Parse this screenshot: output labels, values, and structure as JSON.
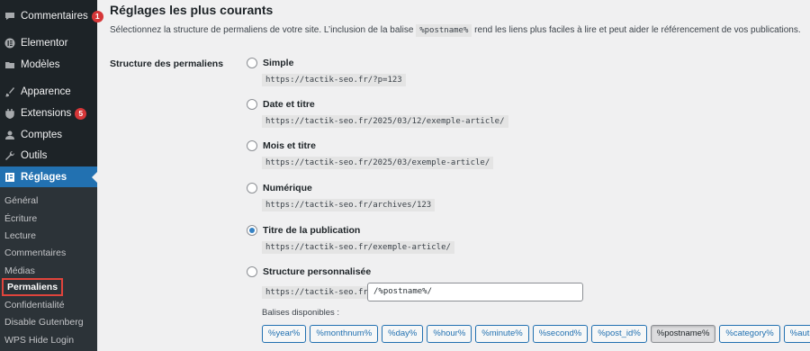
{
  "sidebar": {
    "items": [
      {
        "label": "Commentaires",
        "icon": "comment-icon",
        "badge": "1"
      },
      {
        "label": "Elementor",
        "icon": "elementor-icon"
      },
      {
        "label": "Modèles",
        "icon": "folder-icon"
      },
      {
        "label": "Apparence",
        "icon": "brush-icon"
      },
      {
        "label": "Extensions",
        "icon": "plugin-icon",
        "badge": "5"
      },
      {
        "label": "Comptes",
        "icon": "user-icon"
      },
      {
        "label": "Outils",
        "icon": "wrench-icon"
      },
      {
        "label": "Réglages",
        "icon": "settings-icon"
      }
    ],
    "submenu": [
      "Général",
      "Écriture",
      "Lecture",
      "Commentaires",
      "Médias",
      "Permaliens",
      "Confidentialité",
      "Disable Gutenberg",
      "WPS Hide Login"
    ]
  },
  "section": {
    "title": "Réglages les plus courants",
    "desc_before": "Sélectionnez la structure de permaliens de votre site. L’inclusion de la balise",
    "desc_code": "%postname%",
    "desc_after": "rend les liens plus faciles à lire et peut aider le référencement de vos publications."
  },
  "field_label": "Structure des permaliens",
  "options": [
    {
      "label": "Simple",
      "url": "https://tactik-seo.fr/?p=123",
      "checked": false
    },
    {
      "label": "Date et titre",
      "url": "https://tactik-seo.fr/2025/03/12/exemple-article/",
      "checked": false
    },
    {
      "label": "Mois et titre",
      "url": "https://tactik-seo.fr/2025/03/exemple-article/",
      "checked": false
    },
    {
      "label": "Numérique",
      "url": "https://tactik-seo.fr/archives/123",
      "checked": false
    },
    {
      "label": "Titre de la publication",
      "url": "https://tactik-seo.fr/exemple-article/",
      "checked": true
    },
    {
      "label": "Structure personnalisée",
      "url": "https://tactik-seo.fr",
      "checked": false
    }
  ],
  "custom_value": "/%postname%/",
  "tags_label": "Balises disponibles :",
  "tags": [
    "%year%",
    "%monthnum%",
    "%day%",
    "%hour%",
    "%minute%",
    "%second%",
    "%post_id%",
    "%postname%",
    "%category%",
    "%author%"
  ],
  "pressed_tag": "%postname%",
  "colors": {
    "sidebar_bg": "#1d2327",
    "accent": "#2271b1",
    "badge": "#d63638",
    "highlight_border": "#e0443c"
  }
}
